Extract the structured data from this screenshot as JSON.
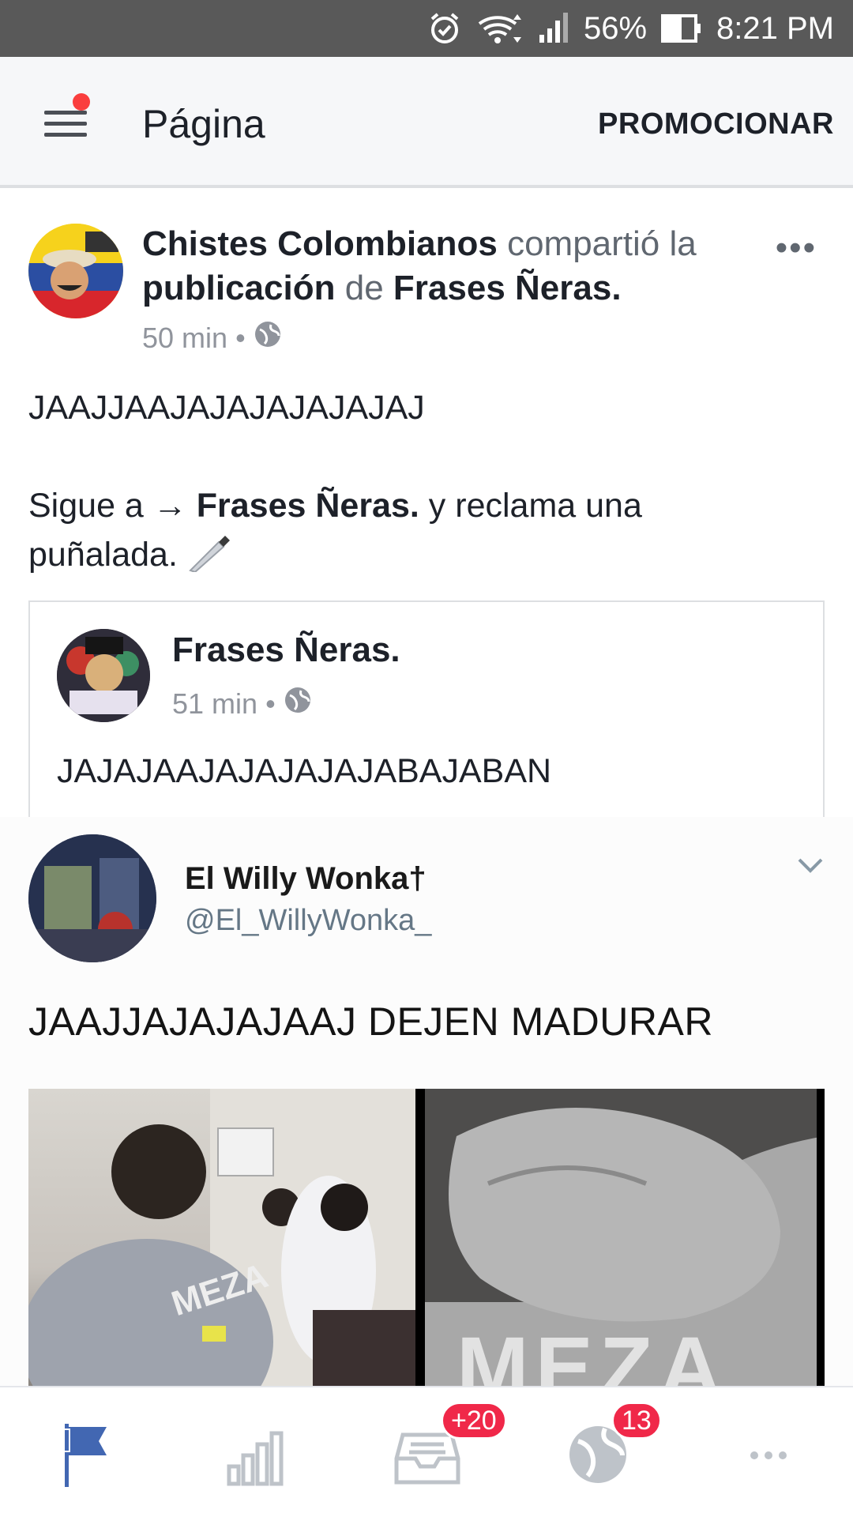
{
  "status_bar": {
    "battery": "56%",
    "time": "8:21 PM"
  },
  "header": {
    "title": "Página",
    "promote_label": "PROMOCIONAR"
  },
  "post": {
    "author": "Chistes Colombianos",
    "shared_text": "compartió la",
    "publication": "publicación",
    "de": "de",
    "source_page": "Frases Ñeras.",
    "time": "50 min",
    "line1": "JAAJJAAJAJAJAJAJAJAJ",
    "line2_prefix": "Sigue a →",
    "line2_page": "Frases Ñeras.",
    "line2_suffix": "y reclama una",
    "line3": "puñalada.",
    "shared_card": {
      "name": "Frases Ñeras.",
      "time": "51 min",
      "text": "JAJAJAAJAJAJAJAJABAJABAN"
    },
    "tweet": {
      "name": "El Willy Wonka†",
      "handle": "@El_WillyWonka_",
      "text": "JAAJJAJAJAJAAJ DEJEN MADURAR",
      "photo_label_left": "MEZA",
      "photo_label_right": "MEZA"
    }
  },
  "bottom_nav": {
    "inbox_badge": "+20",
    "notifications_badge": "13"
  },
  "colors": {
    "accent": "#4267b2",
    "badge": "#f02849",
    "status_bar": "#595959"
  }
}
